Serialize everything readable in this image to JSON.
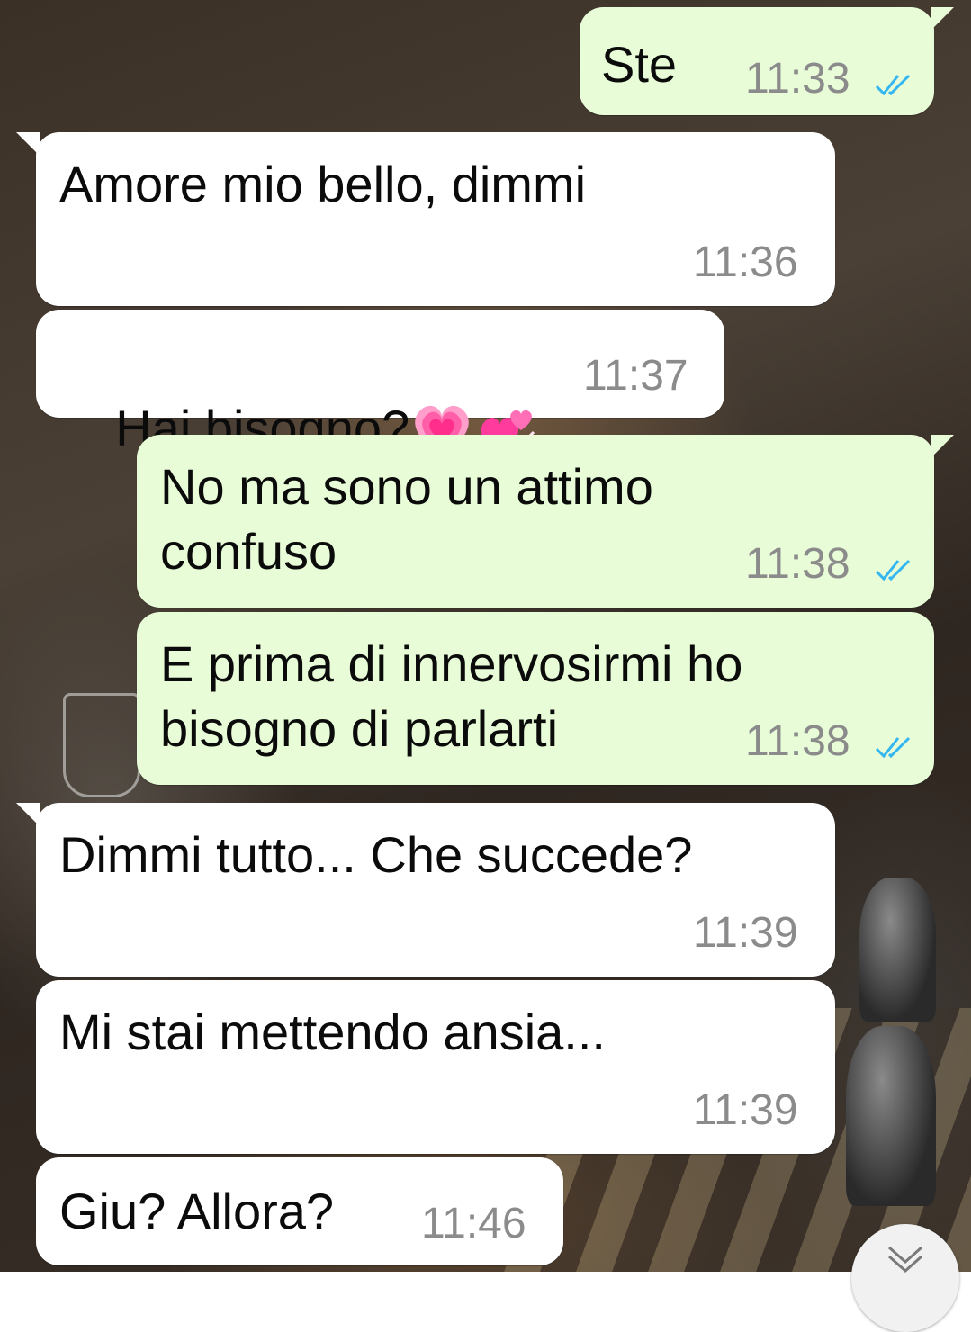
{
  "colors": {
    "incoming_bubble": "#ffffff",
    "outgoing_bubble": "#e7fcd7",
    "read_ticks": "#34b7f1",
    "timestamp": "#8b8b8b"
  },
  "messages": [
    {
      "direction": "outgoing",
      "text": "Ste",
      "time": "11:33",
      "status": "read-ticks-icon"
    },
    {
      "direction": "incoming",
      "text": "Amore mio bello, dimmi",
      "time": "11:36"
    },
    {
      "direction": "incoming",
      "text": "Hai bisogno?",
      "emojis": [
        "growing-heart-emoji",
        "revolving-hearts-emoji"
      ],
      "time": "11:37"
    },
    {
      "direction": "outgoing",
      "text_line1": "No ma sono un attimo",
      "text_line2": "confuso",
      "time": "11:38",
      "status": "read-ticks-icon"
    },
    {
      "direction": "outgoing",
      "text_line1": "E prima di innervosirmi ho",
      "text_line2": "bisogno di parlarti",
      "time": "11:38",
      "status": "read-ticks-icon"
    },
    {
      "direction": "incoming",
      "text": "Dimmi tutto... Che succede?",
      "time": "11:39"
    },
    {
      "direction": "incoming",
      "text": "Mi stai mettendo ansia...",
      "time": "11:39"
    },
    {
      "direction": "incoming",
      "text": "Giu? Allora?",
      "time": "11:46"
    }
  ],
  "scroll_button": {
    "icon": "double-chevron-down-icon"
  }
}
